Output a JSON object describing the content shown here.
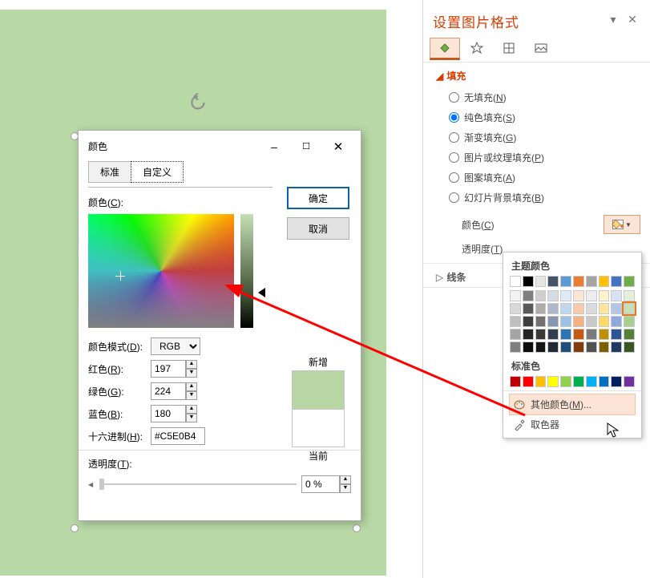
{
  "canvas": {
    "bg": "#b8d8a6"
  },
  "dialog": {
    "title": "颜色",
    "tabs": {
      "standard": "标准",
      "custom": "自定义"
    },
    "ok": "确定",
    "cancel": "取消",
    "color_label": "颜色(C):",
    "mode_label": "颜色模式(D):",
    "mode_value": "RGB",
    "red_label": "红色(R):",
    "red_value": "197",
    "green_label": "绿色(G):",
    "green_value": "224",
    "blue_label": "蓝色(B):",
    "blue_value": "180",
    "hex_label": "十六进制(H):",
    "hex_value": "#C5E0B4",
    "new_label": "新增",
    "current_label": "当前",
    "trans_label": "透明度(T):",
    "trans_value": "0 %"
  },
  "panel": {
    "title": "设置图片格式",
    "sections": {
      "fill": "填充",
      "line": "线条"
    },
    "fill_options": {
      "none": "无填充(N)",
      "solid": "纯色填充(S)",
      "gradient": "渐变填充(G)",
      "picture": "图片或纹理填充(P)",
      "pattern": "图案填充(A)",
      "slidebg": "幻灯片背景填充(B)"
    },
    "color_label": "颜色(C)",
    "trans_label": "透明度(T)"
  },
  "popup": {
    "theme_head": "主题颜色",
    "standard_head": "标准色",
    "more_colors": "其他颜色(M)...",
    "eyedropper": "取色器",
    "theme_row1": [
      "#ffffff",
      "#000000",
      "#e7e6e6",
      "#44546a",
      "#5b9bd5",
      "#ed7d31",
      "#a5a5a5",
      "#ffc000",
      "#4472c4",
      "#70ad47"
    ],
    "theme_tints": [
      [
        "#f2f2f2",
        "#7f7f7f",
        "#d0cece",
        "#d6dce4",
        "#deebf6",
        "#fbe5d5",
        "#ededed",
        "#fff2cc",
        "#d9e2f3",
        "#e2efd9"
      ],
      [
        "#d8d8d8",
        "#595959",
        "#aeabab",
        "#adb9ca",
        "#bdd7ee",
        "#f7cbac",
        "#dbdbdb",
        "#fee599",
        "#b4c6e7",
        "#c5e0b3"
      ],
      [
        "#bfbfbf",
        "#3f3f3f",
        "#757070",
        "#8496b0",
        "#9cc3e5",
        "#f4b183",
        "#c9c9c9",
        "#ffd965",
        "#8eaadb",
        "#a8d08d"
      ],
      [
        "#a5a5a5",
        "#262626",
        "#3a3838",
        "#323f4f",
        "#2e75b5",
        "#c55a11",
        "#7b7b7b",
        "#bf9000",
        "#2f5496",
        "#538135"
      ],
      [
        "#7f7f7f",
        "#0c0c0c",
        "#171616",
        "#222a35",
        "#1e4e79",
        "#833c0b",
        "#525252",
        "#7f6000",
        "#1f3864",
        "#375623"
      ]
    ],
    "standard_row": [
      "#c00000",
      "#ff0000",
      "#ffc000",
      "#ffff00",
      "#92d050",
      "#00b050",
      "#00b0f0",
      "#0070c0",
      "#002060",
      "#7030a0"
    ]
  }
}
